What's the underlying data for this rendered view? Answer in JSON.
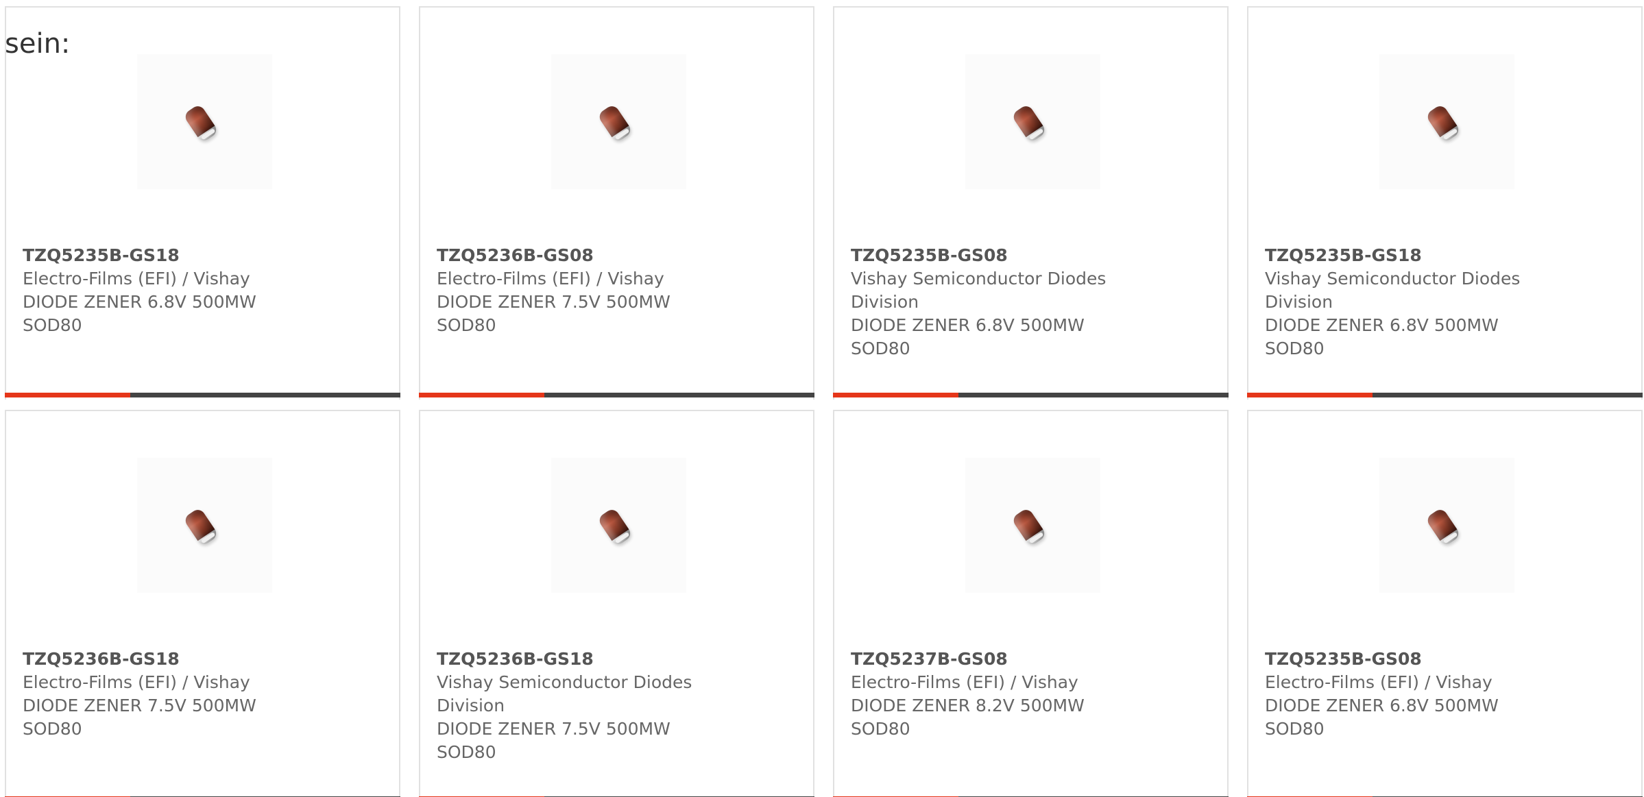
{
  "page": {
    "intro_text": "sein:"
  },
  "products": [
    {
      "part_number": "TZQ5235B-GS18",
      "manufacturer": "Electro-Films (EFI) / Vishay",
      "description": "DIODE ZENER 6.8V 500MW",
      "package": "SOD80"
    },
    {
      "part_number": "TZQ5236B-GS08",
      "manufacturer": "Electro-Films (EFI) / Vishay",
      "description": "DIODE ZENER 7.5V 500MW",
      "package": "SOD80"
    },
    {
      "part_number": "TZQ5235B-GS08",
      "manufacturer": "Vishay Semiconductor Diodes Division",
      "description": "DIODE ZENER 6.8V 500MW",
      "package": "SOD80"
    },
    {
      "part_number": "TZQ5235B-GS18",
      "manufacturer": "Vishay Semiconductor Diodes Division",
      "description": "DIODE ZENER 6.8V 500MW",
      "package": "SOD80"
    },
    {
      "part_number": "TZQ5236B-GS18",
      "manufacturer": "Electro-Films (EFI) / Vishay",
      "description": "DIODE ZENER 7.5V 500MW",
      "package": "SOD80"
    },
    {
      "part_number": "TZQ5236B-GS18",
      "manufacturer": "Vishay Semiconductor Diodes Division",
      "description": "DIODE ZENER 7.5V 500MW",
      "package": "SOD80"
    },
    {
      "part_number": "TZQ5237B-GS08",
      "manufacturer": "Electro-Films (EFI) / Vishay",
      "description": "DIODE ZENER 8.2V 500MW",
      "package": "SOD80"
    },
    {
      "part_number": "TZQ5235B-GS08",
      "manufacturer": "Electro-Films (EFI) / Vishay",
      "description": "DIODE ZENER 6.8V 500MW",
      "package": "SOD80"
    }
  ],
  "theme": {
    "accent_color": "#e5361a",
    "bar_color": "#444444",
    "border_color": "#e1e1e1",
    "text_color": "#666666"
  },
  "icons": {
    "product_image": "zener-diode-icon"
  }
}
